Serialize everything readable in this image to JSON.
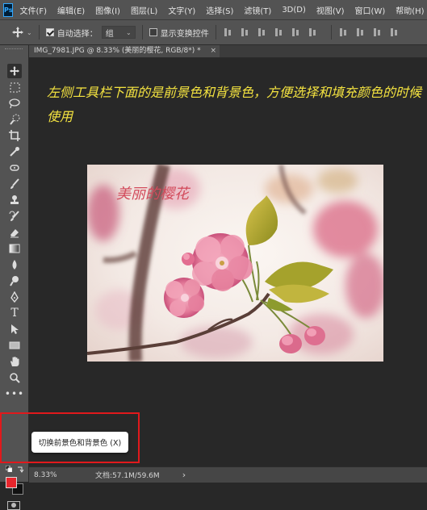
{
  "app": {
    "logo": "Ps"
  },
  "menu": [
    "文件(F)",
    "编辑(E)",
    "图像(I)",
    "图层(L)",
    "文字(Y)",
    "选择(S)",
    "滤镜(T)",
    "3D(D)",
    "视图(V)",
    "窗口(W)",
    "帮助(H)"
  ],
  "options": {
    "auto_select_label": "自动选择：",
    "auto_select_value": "组",
    "show_transform_label": "显示变换控件"
  },
  "document_tab": {
    "title": "IMG_7981.JPG @ 8.33% (美丽的樱花, RGB/8*) *",
    "close": "×"
  },
  "instruction_text": "左侧工具栏下面的是前景色和背景色，方便选择和填充颜色的时候使用",
  "photo": {
    "caption": "美丽的樱花"
  },
  "tooltip": "切换前景色和背景色 (X)",
  "status": {
    "zoom": "8.33%",
    "doc_info": "文档:57.1M/59.6M",
    "arrow": "›"
  },
  "colors": {
    "foreground": "#e8262d",
    "background": "#111111",
    "highlight": "#e1191c",
    "instruction": "#f4e340"
  },
  "tools": [
    "move-icon",
    "marquee-icon",
    "lasso-icon",
    "quick-select-icon",
    "crop-icon",
    "eyedropper-icon",
    "healing-icon",
    "brush-icon",
    "stamp-icon",
    "history-brush-icon",
    "eraser-icon",
    "gradient-icon",
    "blur-icon",
    "dodge-icon",
    "pen-icon",
    "type-icon",
    "path-select-icon",
    "rectangle-icon",
    "hand-icon",
    "zoom-icon",
    "more-icon"
  ]
}
